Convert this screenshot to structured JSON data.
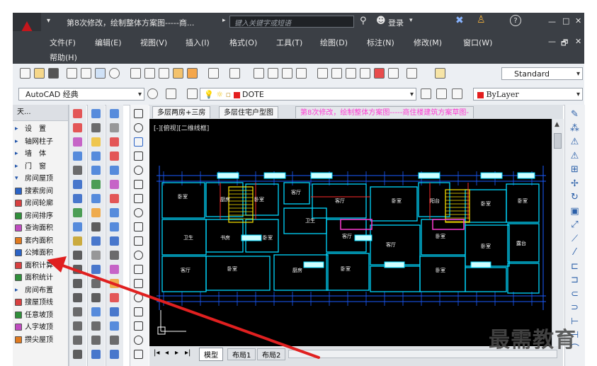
{
  "title_bar": {
    "quick_access_dropdown": "▾",
    "document_title": "第8次修改，绘制整体方案图-----商...",
    "search_placeholder": "键入关键字或短语",
    "login_label": "登录",
    "help_label": "?",
    "window_controls": [
      "—",
      "□",
      "✕"
    ]
  },
  "menu_bar": {
    "items": [
      "文件(F)",
      "编辑(E)",
      "视图(V)",
      "插入(I)",
      "格式(O)",
      "工具(T)",
      "绘图(D)",
      "标注(N)",
      "修改(M)",
      "窗口(W)"
    ],
    "help_item": "帮助(H)",
    "doc_controls": [
      "—",
      "🗗",
      "✕"
    ]
  },
  "toolbar1": {
    "text_style": "Standard"
  },
  "toolbar2": {
    "workspace": "AutoCAD 经典",
    "layer": "DOTE",
    "color": "ByLayer"
  },
  "left_panel": {
    "header": "天...",
    "items": [
      {
        "label": "设　置",
        "icon": "arrow-icon"
      },
      {
        "label": "轴网柱子",
        "icon": "arrow-icon"
      },
      {
        "label": "墙　体",
        "icon": "arrow-icon"
      },
      {
        "label": "门　窗",
        "icon": "arrow-icon"
      },
      {
        "label": "房间屋顶",
        "icon": "expand-icon"
      },
      {
        "label": "搜索房间",
        "icon": "room-search-icon"
      },
      {
        "label": "房间轮廓",
        "icon": "room-outline-icon"
      },
      {
        "label": "房间排序",
        "icon": "room-sort-icon"
      },
      {
        "label": "查询面积",
        "icon": "area-query-icon"
      },
      {
        "label": "套内面积",
        "icon": "inner-area-icon"
      },
      {
        "label": "公摊面积",
        "icon": "shared-area-icon"
      },
      {
        "label": "面积计算",
        "icon": "area-calc-icon"
      },
      {
        "label": "面积统计",
        "icon": "area-stats-icon"
      },
      {
        "label": "房间布置",
        "icon": "arrow-icon"
      },
      {
        "label": "搜屋顶线",
        "icon": "roofline-icon"
      },
      {
        "label": "任意坡顶",
        "icon": "slope-roof-icon"
      },
      {
        "label": "人字坡顶",
        "icon": "gable-roof-icon"
      },
      {
        "label": "攒尖屋顶",
        "icon": "pyramid-roof-icon"
      }
    ]
  },
  "drawing_tabs": [
    {
      "label": "多层两房+三房",
      "active": false
    },
    {
      "label": "多层住宅户型图",
      "active": false
    },
    {
      "label": "第8次修改，绘制整体方案图-----商住楼建筑方案草图-",
      "active": true
    }
  ],
  "viewport_label": "[-][俯视][二维线框]",
  "room_labels": [
    "卧室",
    "厨房",
    "卧室",
    "客厅",
    "客厅",
    "卫生",
    "书房",
    "卧室",
    "卫生",
    "客厅",
    "客厅",
    "卧室",
    "厨房",
    "卧室",
    "卧室",
    "阳台",
    "卧室",
    "卧室",
    "卧室",
    "客厅",
    "卧室",
    "卧室",
    "露台"
  ],
  "layout_tabs": {
    "nav": [
      "|◂",
      "◂",
      "▸",
      "▸|"
    ],
    "tabs": [
      "模型",
      "布局1",
      "布局2"
    ]
  },
  "watermark": "最需教育",
  "colors": {
    "app_red": "#c4161c",
    "cad_background": "#000000",
    "wall_cyan": "#00d8ff",
    "dimension_blue": "#1a5bff",
    "stair_yellow": "#ffe600",
    "annotation_red": "#ff2a2a",
    "active_tab_magenta": "#ff3bd4",
    "arrow_red": "#e02020"
  }
}
